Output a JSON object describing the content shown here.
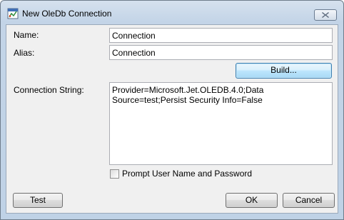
{
  "window": {
    "title": "New OleDb Connection"
  },
  "form": {
    "name_label": "Name:",
    "name_value": "Connection",
    "alias_label": "Alias:",
    "alias_value": "Connection",
    "build_label": "Build...",
    "connection_string_label": "Connection String:",
    "connection_string_value": "Provider=Microsoft.Jet.OLEDB.4.0;Data Source=test;Persist Security Info=False",
    "prompt_label": "Prompt User Name and Password",
    "prompt_checked": false
  },
  "footer": {
    "test_label": "Test",
    "ok_label": "OK",
    "cancel_label": "Cancel"
  },
  "icons": {
    "app": "dialog-app-icon",
    "close": "close-icon"
  }
}
